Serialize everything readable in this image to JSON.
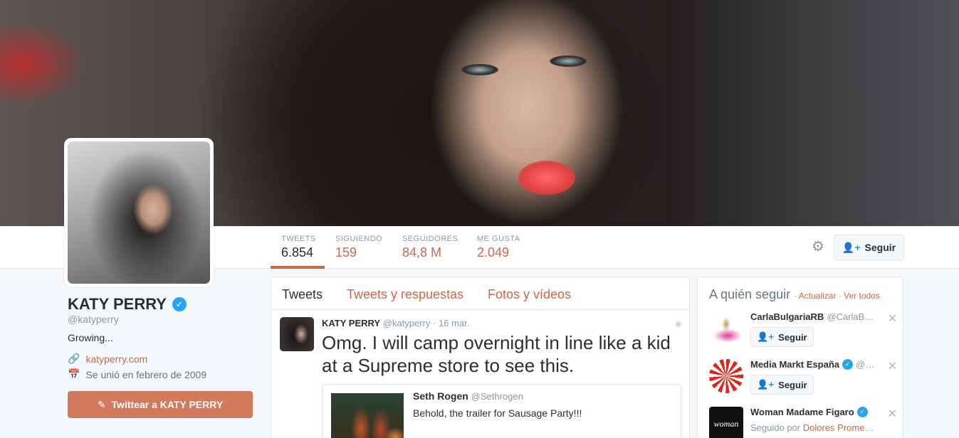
{
  "nav": {
    "stats": [
      {
        "label": "TWEETS",
        "value": "6.854"
      },
      {
        "label": "SIGUIENDO",
        "value": "159"
      },
      {
        "label": "SEGUIDORES",
        "value": "84,8 M"
      },
      {
        "label": "ME GUSTA",
        "value": "2.049"
      }
    ],
    "follow_label": "Seguir",
    "gear_icon": "gear-icon"
  },
  "profile": {
    "name": "KATY PERRY",
    "handle": "@katyperry",
    "bio": "Growing...",
    "url": "katyperry.com",
    "joined": "Se unió en febrero de 2009",
    "tweet_to_label": "Twittear a KATY PERRY"
  },
  "timeline": {
    "tabs": [
      "Tweets",
      "Tweets y respuestas",
      "Fotos y vídeos"
    ],
    "tweet": {
      "name": "KATY PERRY",
      "handle": "@katyperry",
      "date": "· 16 mar.",
      "text": "Omg. I will camp overnight in line like a kid at a Supreme store to see this.",
      "quote": {
        "name": "Seth Rogen",
        "handle": "@Sethrogen",
        "text": "Behold, the trailer for Sausage Party!!!"
      }
    }
  },
  "who_to_follow": {
    "title": "A quién seguir",
    "sep": "·",
    "refresh_label": "Actualizar",
    "view_all_label": "Ver todos",
    "items": [
      {
        "name": "CarlaBulgariaRB",
        "handle": "@CarlaBul…",
        "verified": false,
        "follow_label": "Seguir"
      },
      {
        "name": "Media Markt España",
        "handle": "@M…",
        "verified": true,
        "follow_label": "Seguir"
      },
      {
        "name": "Woman Madame Figaro",
        "handle": "",
        "verified": true,
        "followed_by_prefix": "Seguido por",
        "followed_by": "Dolores Promes…",
        "avatar_text": "woman"
      }
    ]
  },
  "colors": {
    "accent": "#c9684a",
    "button_accent": "#d17a5d",
    "verified": "#2aa3ef"
  }
}
